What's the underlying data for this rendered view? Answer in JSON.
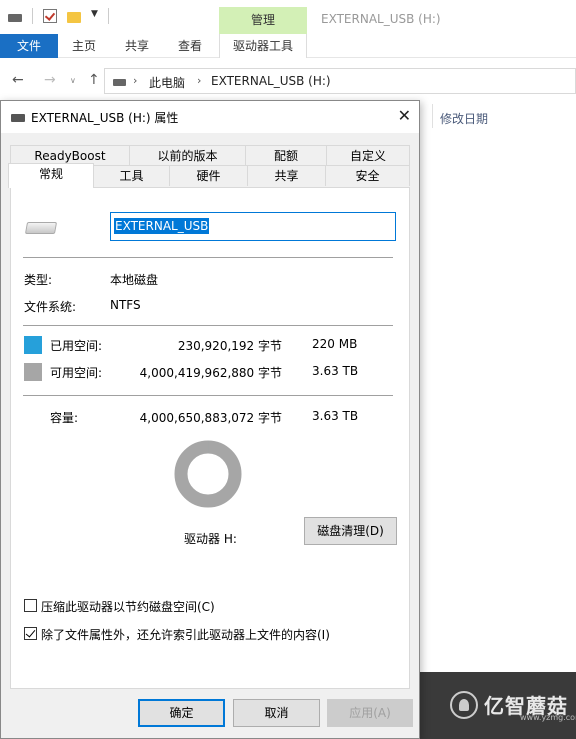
{
  "explorer": {
    "manage_tab": "管理",
    "window_title": "EXTERNAL_USB (H:)",
    "ribbon_tabs": [
      "文件",
      "主页",
      "共享",
      "查看",
      "驱动器工具"
    ],
    "address": {
      "crumb1": "此电脑",
      "crumb2": "EXTERNAL_USB (H:)"
    },
    "column_header": "修改日期"
  },
  "dialog": {
    "title": "EXTERNAL_USB (H:) 属性",
    "tabs_row_back": [
      "ReadyBoost",
      "以前的版本",
      "配额",
      "自定义"
    ],
    "tabs_row_front": [
      "常规",
      "工具",
      "硬件",
      "共享",
      "安全"
    ],
    "active_tab": "常规",
    "volume_name": "EXTERNAL_USB",
    "type_label": "类型:",
    "type_value": "本地磁盘",
    "fs_label": "文件系统:",
    "fs_value": "NTFS",
    "used": {
      "label": "已用空间:",
      "bytes": "230,920,192 字节",
      "size": "220 MB",
      "color": "#26a0da"
    },
    "free": {
      "label": "可用空间:",
      "bytes": "4,000,419,962,880 字节",
      "size": "3.63 TB",
      "color": "#a6a6a6"
    },
    "capacity": {
      "label": "容量:",
      "bytes": "4,000,650,883,072 字节",
      "size": "3.63 TB"
    },
    "drive_label": "驱动器 H:",
    "cleanup_button": "磁盘清理(D)",
    "compress_label": "压缩此驱动器以节约磁盘空间(C)",
    "compress_checked": false,
    "index_label": "除了文件属性外，还允许索引此驱动器上文件的内容(I)",
    "index_checked": true,
    "ok": "确定",
    "cancel": "取消",
    "apply": "应用(A)"
  },
  "watermark": {
    "text": "亿智蘑菇",
    "sub": "www.yzmg.com"
  }
}
